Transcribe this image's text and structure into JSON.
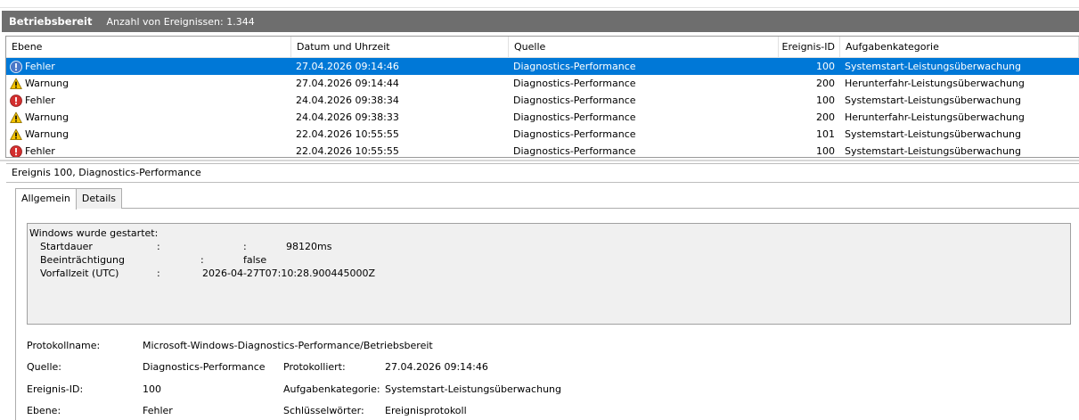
{
  "header": {
    "log_name": "Betriebsbereit",
    "event_count": "Anzahl von Ereignissen: 1.344"
  },
  "columns": {
    "level": "Ebene",
    "date": "Datum und Uhrzeit",
    "source": "Quelle",
    "id": "Ereignis-ID",
    "category": "Aufgabenkategorie"
  },
  "events": [
    {
      "level": "Fehler",
      "icon": "error-icon",
      "date": "27.04.2026 09:14:46",
      "source": "Diagnostics-Performance",
      "id": "100",
      "category": "Systemstart-Leistungsüberwachung",
      "selected": true
    },
    {
      "level": "Warnung",
      "icon": "warning-icon",
      "date": "27.04.2026 09:14:44",
      "source": "Diagnostics-Performance",
      "id": "200",
      "category": "Herunterfahr-Leistungsüberwachung"
    },
    {
      "level": "Fehler",
      "icon": "error-icon",
      "date": "24.04.2026 09:38:34",
      "source": "Diagnostics-Performance",
      "id": "100",
      "category": "Systemstart-Leistungsüberwachung"
    },
    {
      "level": "Warnung",
      "icon": "warning-icon",
      "date": "24.04.2026 09:38:33",
      "source": "Diagnostics-Performance",
      "id": "200",
      "category": "Herunterfahr-Leistungsüberwachung"
    },
    {
      "level": "Warnung",
      "icon": "warning-icon",
      "date": "22.04.2026 10:55:55",
      "source": "Diagnostics-Performance",
      "id": "101",
      "category": "Systemstart-Leistungsüberwachung"
    },
    {
      "level": "Fehler",
      "icon": "error-icon",
      "date": "22.04.2026 10:55:55",
      "source": "Diagnostics-Performance",
      "id": "100",
      "category": "Systemstart-Leistungsüberwachung"
    }
  ],
  "details": {
    "title": "Ereignis 100, Diagnostics-Performance",
    "tabs": [
      "Allgemein",
      "Details"
    ],
    "message": {
      "heading": "Windows wurde gestartet:",
      "startdauer_label": "Startdauer",
      "startdauer_sep1": ":",
      "startdauer_sep2": ":",
      "startdauer_value": "98120ms",
      "beeintraechtigung_label": "Beeinträchtigung",
      "beeintraechtigung_sep": ":",
      "beeintraechtigung_value": "false",
      "vorfallzeit_label": "Vorfallzeit (UTC)",
      "vorfallzeit_sep": ":",
      "vorfallzeit_value": "2026-04-27T07:10:28.900445000Z"
    },
    "props": {
      "protokollname_label": "Protokollname:",
      "protokollname_value": "Microsoft-Windows-Diagnostics-Performance/Betriebsbereit",
      "quelle_label": "Quelle:",
      "quelle_value": "Diagnostics-Performance",
      "protokolliert_label": "Protokolliert:",
      "protokolliert_value": "27.04.2026 09:14:46",
      "ereignisid_label": "Ereignis-ID:",
      "ereignisid_value": "100",
      "aufgabenkategorie_label": "Aufgabenkategorie:",
      "aufgabenkategorie_value": "Systemstart-Leistungsüberwachung",
      "ebene_label": "Ebene:",
      "ebene_value": "Fehler",
      "schluesselwoerter_label": "Schlüsselwörter:",
      "schluesselwoerter_value": "Ereignisprotokoll"
    }
  },
  "colors": {
    "title_bar": "#6e6e6e",
    "selection": "#0078d7",
    "error": "#d32f2f",
    "warning": "#f5c400"
  }
}
